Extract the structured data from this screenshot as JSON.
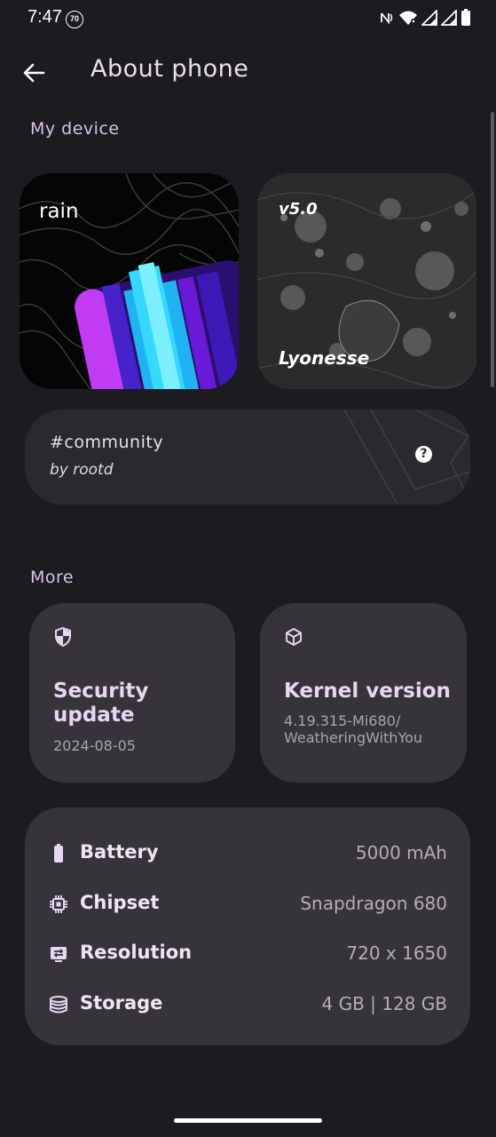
{
  "status_bar": {
    "time": "7:47",
    "badge": "70",
    "icons": [
      "nfc-icon",
      "wifi-icon",
      "signal-icon",
      "signal-icon",
      "battery-icon"
    ]
  },
  "app_bar": {
    "back_icon": "arrow-back-icon",
    "title": "About phone"
  },
  "my_device": {
    "section_label": "My device",
    "rain_card": {
      "label": "rain"
    },
    "lyonesse_card": {
      "version": "v5.0",
      "name": "Lyonesse"
    },
    "community": {
      "title": "#community",
      "subtitle": "by rootd",
      "help_icon": "help-icon",
      "help_glyph": "?"
    }
  },
  "more": {
    "section_label": "More",
    "security": {
      "icon": "shield-icon",
      "title": "Security update",
      "value": "2024-08-05"
    },
    "kernel": {
      "icon": "cube-icon",
      "title": "Kernel version",
      "value_line1": "4.19.315-Mi680/",
      "value_line2": "WeatheringWithYou"
    }
  },
  "specs": [
    {
      "icon": "battery-icon",
      "label": "Battery",
      "value": "5000 mAh"
    },
    {
      "icon": "chip-icon",
      "label": "Chipset",
      "value": "Snapdragon 680"
    },
    {
      "icon": "display-icon",
      "label": "Resolution",
      "value": "720 x 1650"
    },
    {
      "icon": "storage-icon",
      "label": "Storage",
      "value": "4 GB | 128 GB"
    }
  ],
  "colors": {
    "background": "#1c1b1f",
    "card": "#36343a",
    "accent": "#e8d6f3",
    "muted": "#b3adb8"
  }
}
